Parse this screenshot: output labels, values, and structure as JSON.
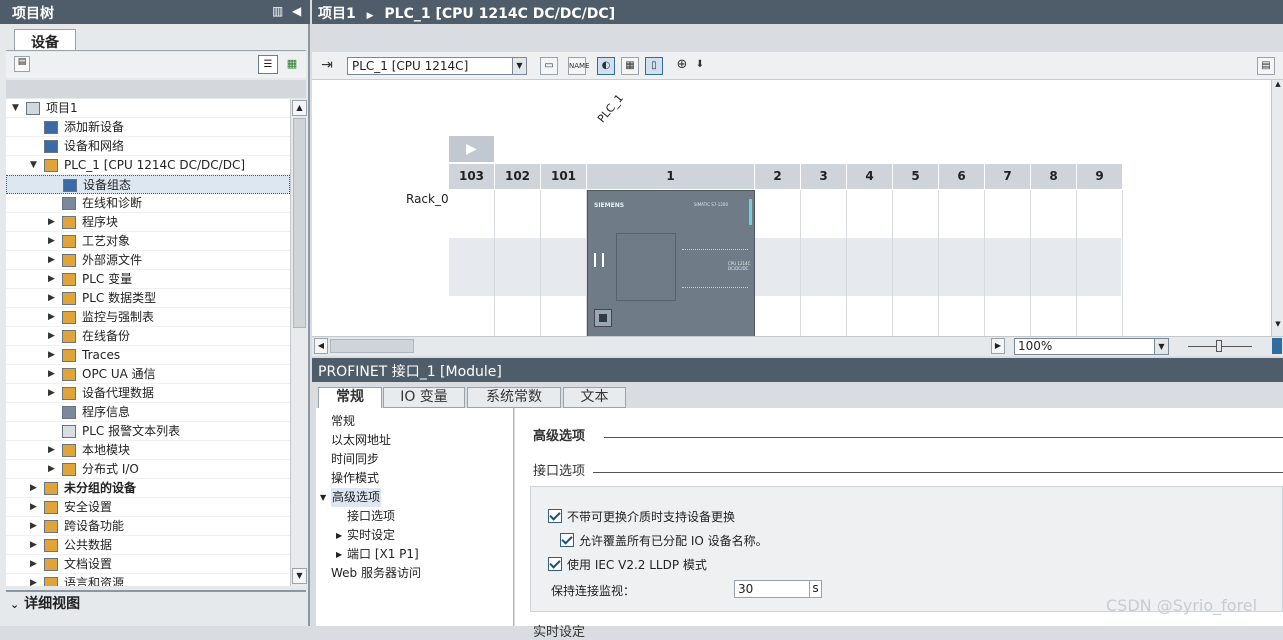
{
  "left_panel": {
    "title": "项目树",
    "tab": "设备",
    "detail_view": "详细视图",
    "tree": [
      {
        "label": "项目1",
        "depth": 0,
        "arrow": "▼",
        "icon": "project-icon"
      },
      {
        "label": "添加新设备",
        "depth": 1,
        "arrow": "",
        "icon": "add-device-icon"
      },
      {
        "label": "设备和网络",
        "depth": 1,
        "arrow": "",
        "icon": "network-icon"
      },
      {
        "label": "PLC_1 [CPU 1214C DC/DC/DC]",
        "depth": 1,
        "arrow": "▼",
        "icon": "plc-icon"
      },
      {
        "label": "设备组态",
        "depth": 2,
        "arrow": "",
        "icon": "device-config-icon",
        "selected": true
      },
      {
        "label": "在线和诊断",
        "depth": 2,
        "arrow": "",
        "icon": "diagnostics-icon"
      },
      {
        "label": "程序块",
        "depth": 2,
        "arrow": "▶",
        "icon": "folder-icon"
      },
      {
        "label": "工艺对象",
        "depth": 2,
        "arrow": "▶",
        "icon": "folder-icon"
      },
      {
        "label": "外部源文件",
        "depth": 2,
        "arrow": "▶",
        "icon": "folder-icon"
      },
      {
        "label": "PLC 变量",
        "depth": 2,
        "arrow": "▶",
        "icon": "folder-icon"
      },
      {
        "label": "PLC 数据类型",
        "depth": 2,
        "arrow": "▶",
        "icon": "folder-icon"
      },
      {
        "label": "监控与强制表",
        "depth": 2,
        "arrow": "▶",
        "icon": "folder-icon"
      },
      {
        "label": "在线备份",
        "depth": 2,
        "arrow": "▶",
        "icon": "folder-icon"
      },
      {
        "label": "Traces",
        "depth": 2,
        "arrow": "▶",
        "icon": "folder-icon"
      },
      {
        "label": "OPC UA 通信",
        "depth": 2,
        "arrow": "▶",
        "icon": "folder-icon"
      },
      {
        "label": "设备代理数据",
        "depth": 2,
        "arrow": "▶",
        "icon": "folder-icon"
      },
      {
        "label": "程序信息",
        "depth": 2,
        "arrow": "",
        "icon": "info-icon"
      },
      {
        "label": "PLC 报警文本列表",
        "depth": 2,
        "arrow": "",
        "icon": "text-list-icon"
      },
      {
        "label": "本地模块",
        "depth": 2,
        "arrow": "▶",
        "icon": "folder-icon"
      },
      {
        "label": "分布式 I/O",
        "depth": 2,
        "arrow": "▶",
        "icon": "folder-icon"
      },
      {
        "label": "未分组的设备",
        "depth": 1,
        "arrow": "▶",
        "icon": "folder-icon",
        "bold": true
      },
      {
        "label": "安全设置",
        "depth": 1,
        "arrow": "▶",
        "icon": "folder-icon"
      },
      {
        "label": "跨设备功能",
        "depth": 1,
        "arrow": "▶",
        "icon": "folder-icon"
      },
      {
        "label": "公共数据",
        "depth": 1,
        "arrow": "▶",
        "icon": "folder-icon"
      },
      {
        "label": "文档设置",
        "depth": 1,
        "arrow": "▶",
        "icon": "folder-icon"
      },
      {
        "label": "语言和资源",
        "depth": 1,
        "arrow": "▶",
        "icon": "folder-icon"
      }
    ]
  },
  "editor": {
    "breadcrumb_root": "项目1",
    "breadcrumb_sep": "▶",
    "breadcrumb_item": "PLC_1 [CPU 1214C DC/DC/DC]",
    "device_select": "PLC_1 [CPU 1214C]",
    "device_label": "PLC_1",
    "rack_label": "Rack_0",
    "slots": [
      "103",
      "102",
      "101",
      "1",
      "2",
      "3",
      "4",
      "5",
      "6",
      "7",
      "8",
      "9"
    ],
    "cpu_brand": "SIEMENS",
    "cpu_model": "SIMATIC S7-1200",
    "cpu_type": "CPU 1214C DC/DC/DC",
    "zoom": "100%"
  },
  "inspector": {
    "title": "PROFINET 接口_1 [Module]",
    "tabs": [
      "常规",
      "IO 变量",
      "系统常数",
      "文本"
    ],
    "nav": [
      {
        "label": "常规",
        "indent": 0,
        "arrow": ""
      },
      {
        "label": "以太网地址",
        "indent": 0,
        "arrow": ""
      },
      {
        "label": "时间同步",
        "indent": 0,
        "arrow": ""
      },
      {
        "label": "操作模式",
        "indent": 0,
        "arrow": ""
      },
      {
        "label": "高级选项",
        "indent": 0,
        "arrow": "▼",
        "selected": true
      },
      {
        "label": "接口选项",
        "indent": 1,
        "arrow": ""
      },
      {
        "label": "实时设定",
        "indent": 1,
        "arrow": "▶"
      },
      {
        "label": "端口 [X1 P1]",
        "indent": 1,
        "arrow": "▶"
      },
      {
        "label": "Web 服务器访问",
        "indent": 0,
        "arrow": ""
      }
    ],
    "section_title": "高级选项",
    "subsection_title": "接口选项",
    "options": [
      {
        "label": "不带可更换介质时支持设备更换",
        "checked": true
      },
      {
        "label": "允许覆盖所有已分配 IO 设备名称。",
        "checked": true
      },
      {
        "label": "使用 IEC V2.2 LLDP 模式",
        "checked": true
      }
    ],
    "keepalive_label": "保持连接监视：",
    "keepalive_value": "30",
    "keepalive_unit": "s",
    "next_section_partial": "实时设定"
  },
  "watermark": "CSDN @Syrio_forel"
}
